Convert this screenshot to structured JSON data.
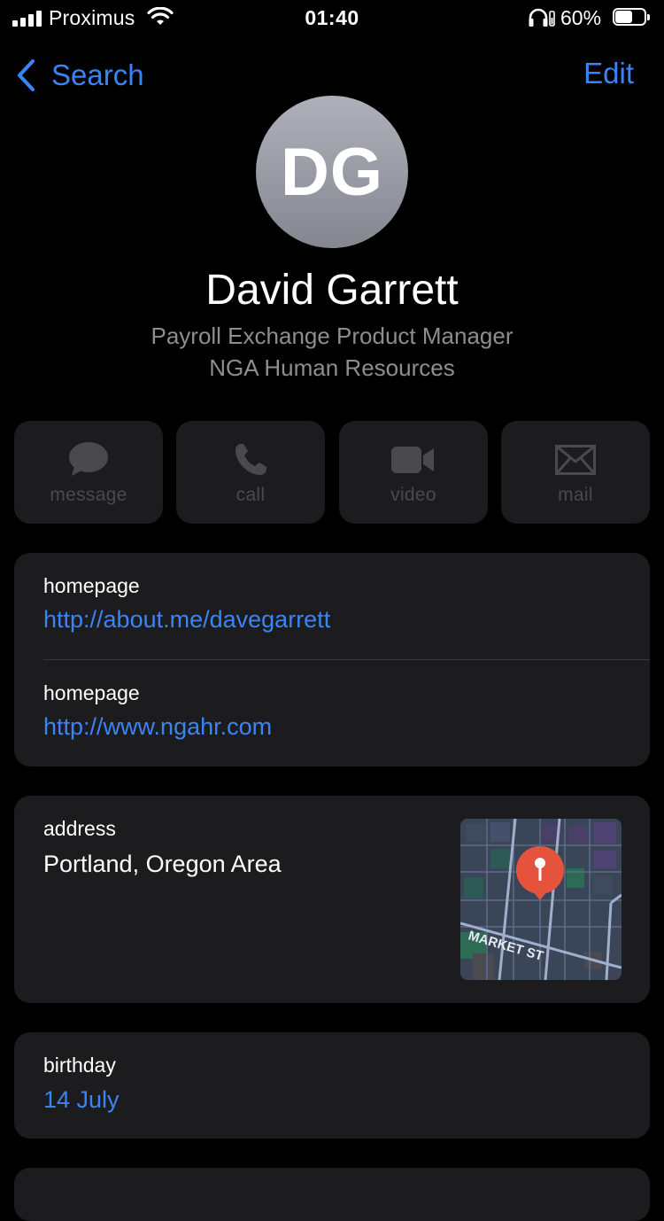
{
  "status_bar": {
    "carrier": "Proximus",
    "time": "01:40",
    "battery_percent": "60%",
    "battery_level": 0.6
  },
  "nav": {
    "back_label": "Search",
    "edit_label": "Edit"
  },
  "contact": {
    "initials": "DG",
    "name": "David Garrett",
    "job_title": "Payroll Exchange Product Manager",
    "company": "NGA Human Resources"
  },
  "actions": [
    {
      "label": "message",
      "icon": "message-icon"
    },
    {
      "label": "call",
      "icon": "phone-icon"
    },
    {
      "label": "video",
      "icon": "video-icon"
    },
    {
      "label": "mail",
      "icon": "mail-icon"
    }
  ],
  "homepages": [
    {
      "label": "homepage",
      "value": "http://about.me/davegarrett"
    },
    {
      "label": "homepage",
      "value": "http://www.ngahr.com"
    }
  ],
  "address": {
    "label": "address",
    "value": "Portland, Oregon Area",
    "map_street_label": "MARKET ST"
  },
  "birthday": {
    "label": "birthday",
    "value": "14 July"
  },
  "colors": {
    "accent": "#3a84f5",
    "card_background": "#1c1c1e",
    "secondary_text": "#8d8d92",
    "map_pin": "#e5533d"
  }
}
